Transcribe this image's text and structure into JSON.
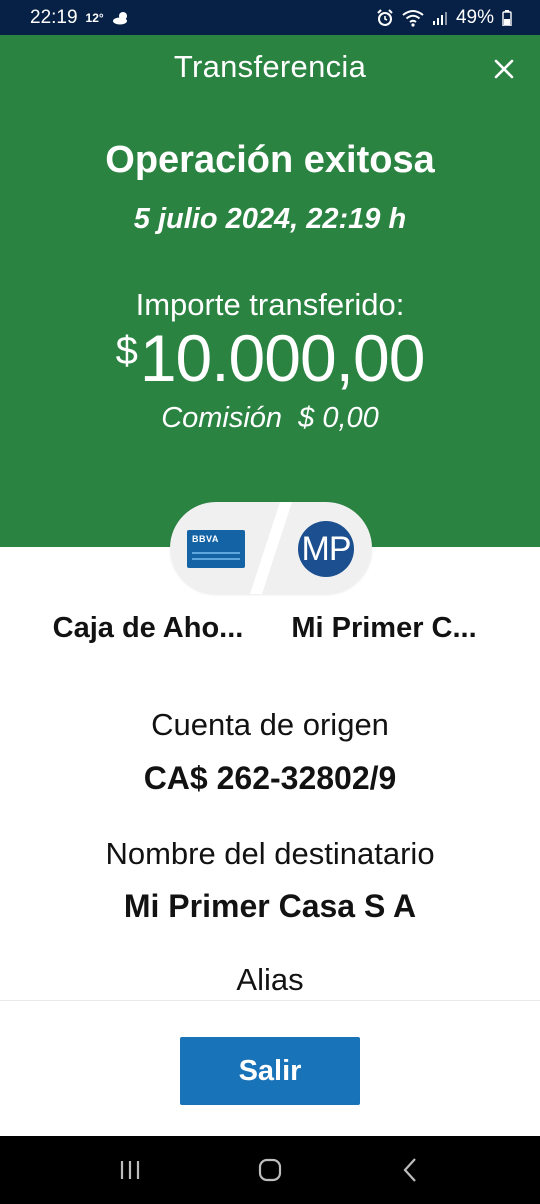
{
  "status_bar": {
    "time": "22:19",
    "temperature": "12°",
    "battery": "49%",
    "icons": [
      "weather-icon",
      "alarm-icon",
      "wifi-icon",
      "signal-icon",
      "battery-icon"
    ]
  },
  "header": {
    "title": "Transferencia",
    "close_icon": "close-icon"
  },
  "operation": {
    "title": "Operación exitosa",
    "date": "5 julio 2024, 22:19 h",
    "amount_label": "Importe transferido:",
    "currency_symbol": "$",
    "amount": "10.000,00",
    "commission": "Comisión  $ 0,00"
  },
  "accounts": {
    "origin_logo": "BBVA",
    "origin_name": "Caja de Aho...",
    "dest_initials": "MP",
    "dest_name": "Mi Primer C..."
  },
  "details": [
    {
      "label": "Cuenta de origen",
      "value": "CA$ 262-32802/9"
    },
    {
      "label": "Nombre del destinatario",
      "value": "Mi Primer Casa S A"
    },
    {
      "label": "Alias",
      "value": ""
    }
  ],
  "footer": {
    "exit_label": "Salir"
  },
  "nav": {
    "icons": [
      "recent-apps-icon",
      "home-icon",
      "back-icon"
    ]
  },
  "colors": {
    "status_bar": "#072146",
    "header_green": "#2b8342",
    "button_blue": "#1973b8",
    "avatar_blue": "#1b4f8f",
    "card_blue": "#1464a5"
  }
}
